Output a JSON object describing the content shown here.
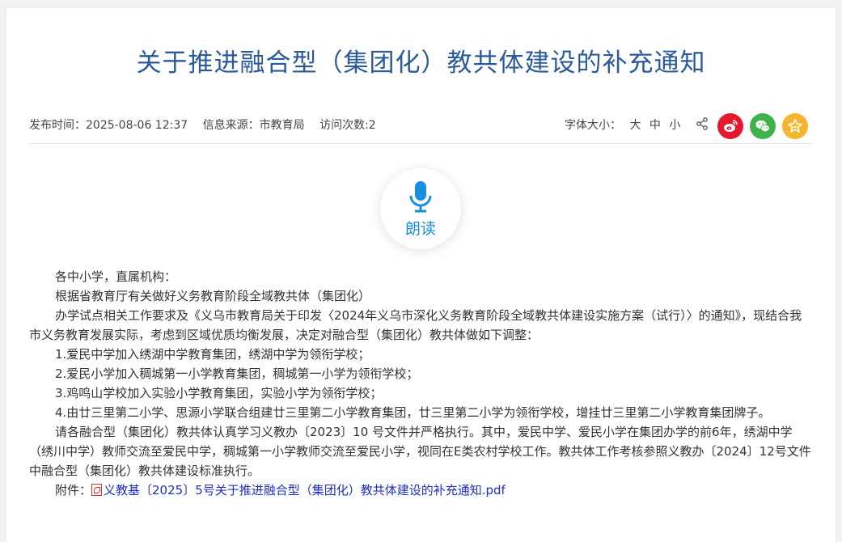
{
  "article": {
    "title": "关于推进融合型（集团化）教共体建设的补充通知",
    "publish_time": "发布时间：2025-08-06 12:37",
    "source": "信息来源：市教育局",
    "visits": "访问次数:2"
  },
  "font_size": {
    "label": "字体大小：",
    "large": "大",
    "medium": "中",
    "small": "小"
  },
  "share": {
    "icons": [
      "share-icon",
      "weibo-icon",
      "wechat-icon",
      "favorite-icon"
    ],
    "colors": {
      "weibo": "#e6162d",
      "wechat": "#3fb24a",
      "favorite": "#f5b52e"
    }
  },
  "listen": {
    "label": "朗读",
    "color": "#1a8fe0"
  },
  "body": {
    "paragraphs": [
      "各中小学，直属机构：",
      "根据省教育厅有关做好义务教育阶段全域教共体（集团化）",
      "办学试点相关工作要求及《义乌市教育局关于印发〈2024年义乌市深化义务教育阶段全域教共体建设实施方案（试行）〉的通知》，现结合我市义务教育发展实际，考虑到区域优质均衡发展，决定对融合型（集团化）教共体做如下调整：",
      "1.爱民中学加入绣湖中学教育集团，绣湖中学为领衔学校；",
      "2.爱民小学加入稠城第一小学教育集团，稠城第一小学为领衔学校；",
      "3.鸡鸣山学校加入实验小学教育集团，实验小学为领衔学校；",
      "4.由廿三里第二小学、思源小学联合组建廿三里第二小学教育集团，廿三里第二小学为领衔学校，增挂廿三里第二小学教育集团牌子。",
      "请各融合型（集团化）教共体认真学习义教办〔2023〕10 号文件并严格执行。其中，爱民中学、爱民小学在集团办学的前6年，绣湖中学（绣川中学）教师交流至爱民中学，稠城第一小学教师交流至爱民小学，视同在E类农村学校工作。教共体工作考核参照义教办〔2024〕12号文件中融合型（集团化）教共体建设标准执行。"
    ],
    "attachment_label": "附件：",
    "attachment_name": "义教基〔2025〕5号关于推进融合型（集团化）教共体建设的补充通知.pdf"
  }
}
